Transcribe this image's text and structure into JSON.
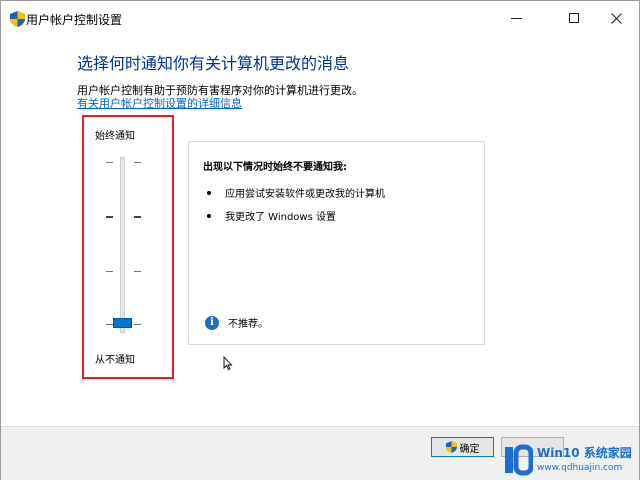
{
  "window": {
    "title": "用户帐户控制设置"
  },
  "main": {
    "heading": "选择何时通知你有关计算机更改的消息",
    "description": "用户帐户控制有助于预防有害程序对你的计算机进行更改。",
    "link_text": "有关用户帐户控制设置的详细信息"
  },
  "slider": {
    "top_label": "始终通知",
    "bottom_label": "从不通知",
    "level": 0,
    "levels_total": 4
  },
  "info": {
    "title": "出现以下情况时始终不要通知我:",
    "bullets": [
      "应用尝试安装软件或更改我的计算机",
      "我更改了 Windows 设置"
    ],
    "note": "不推荐。"
  },
  "footer": {
    "ok_label": "确定"
  },
  "watermark": {
    "brand": "Win10 系统家园",
    "url": "www.qdhuajin.com"
  },
  "colors": {
    "heading": "#003399",
    "link": "#0066cc",
    "highlight_border": "#e0202a",
    "accent": "#0078d7"
  }
}
